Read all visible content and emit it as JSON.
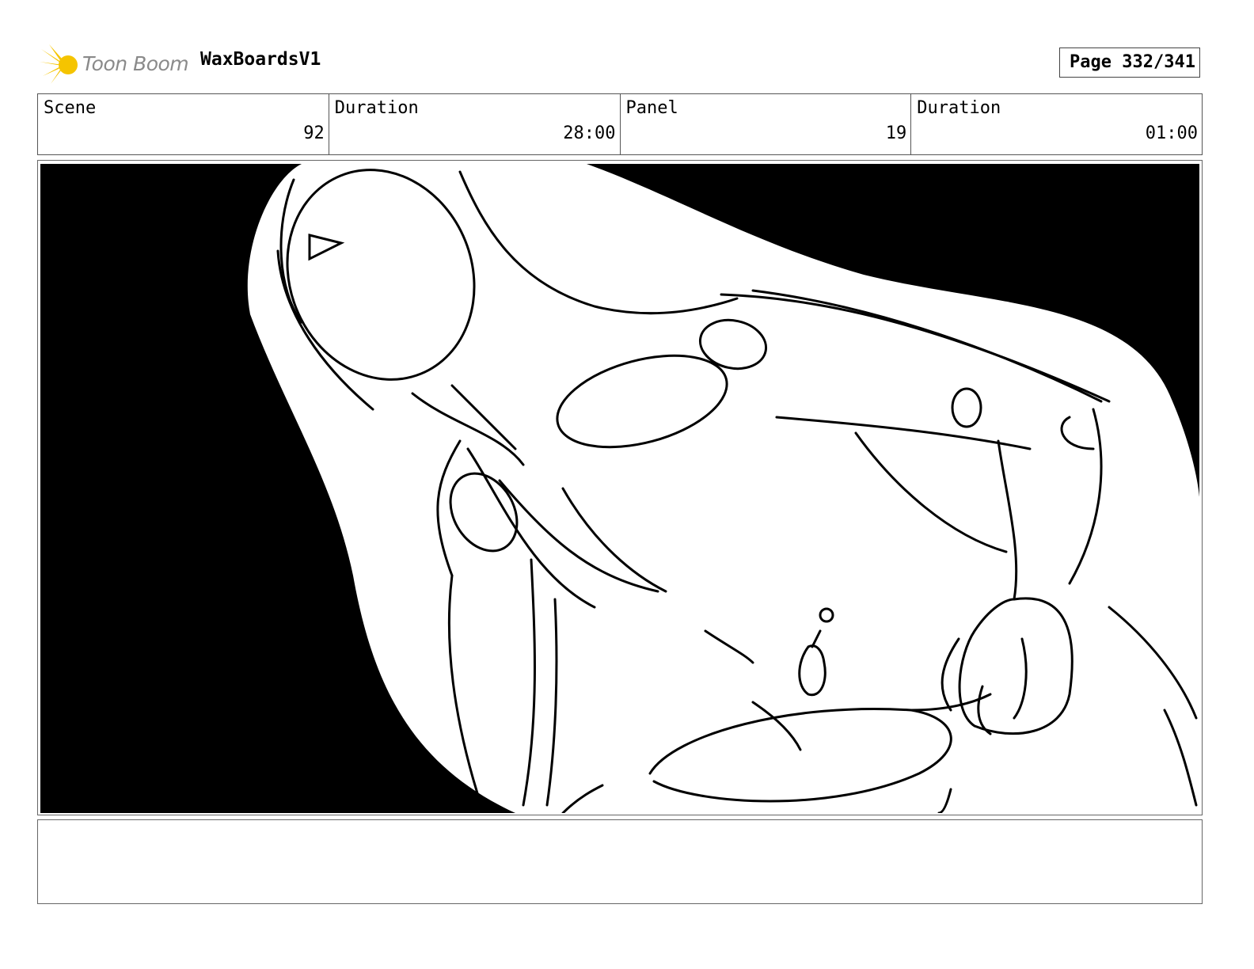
{
  "header": {
    "logo_text": "Toon Boom",
    "project_title": "WaxBoardsV1",
    "page_label": "Page 332/341"
  },
  "info": {
    "scene_label": "Scene",
    "scene_value": "92",
    "scene_duration_label": "Duration",
    "scene_duration_value": "28:00",
    "panel_label": "Panel",
    "panel_value": "19",
    "panel_duration_label": "Duration",
    "panel_duration_value": "01:00"
  },
  "colors": {
    "logo_star": "#f5c400",
    "logo_text": "#8a8a8a",
    "panel_background": "#000000",
    "sketch_fill": "#ffffff"
  },
  "notes": {
    "text": ""
  }
}
